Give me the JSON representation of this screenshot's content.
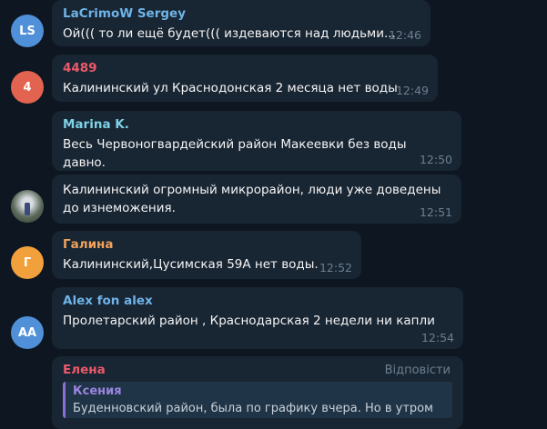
{
  "messages": [
    {
      "avatar_text": "LS",
      "avatar_color": "#4f90d9",
      "sender": "LaCrimoW Sergey",
      "sender_color": "#6fb4e8",
      "text": "Ой((( то ли ещё будет((( издеваются над людьми...",
      "time": "12:46"
    },
    {
      "avatar_text": "4",
      "avatar_color": "#e2634f",
      "sender": "4489",
      "sender_color": "#ea5a6a",
      "text": "Калининский ул Краснодонская 2 месяца нет воды",
      "time": "12:49"
    },
    {
      "sender": "Marina K.",
      "sender_color": "#7ed1e6",
      "text": "Весь Червоногвардейский район Макеевки без воды давно.",
      "time": "12:50"
    },
    {
      "avatar_icon": "user-photo-icon",
      "text": "Калининский огромный микрорайон, люди уже доведены до изнеможения.",
      "time": "12:51"
    },
    {
      "avatar_text": "Г",
      "avatar_color": "#f2a03c",
      "sender": "Галина",
      "sender_color": "#f2a25b",
      "text": "Калининский,Цусимская 59А нет воды.",
      "time": "12:52"
    },
    {
      "avatar_text": "AA",
      "avatar_color": "#4f90d9",
      "sender": "Alex fon alex",
      "sender_color": "#6fb4e8",
      "text": "Пролетарский район , Краснодарская 2 недели ни капли",
      "time": "12:54"
    },
    {
      "sender": "Елена",
      "sender_color": "#ea5a6a",
      "reply_label": "Відповісти",
      "quote_name": "Ксения",
      "quote_text": "Буденновский район, была по графику вчера. Но в утром"
    }
  ]
}
